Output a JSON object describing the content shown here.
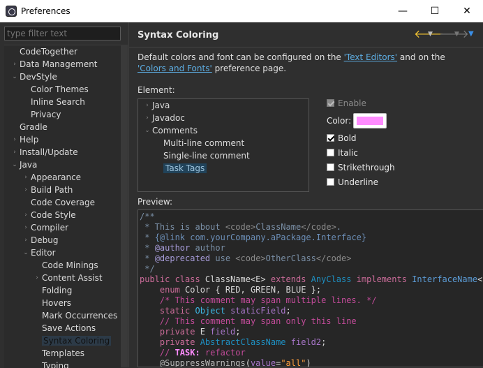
{
  "window": {
    "title": "Preferences",
    "minimize": "—",
    "maximize": "☐",
    "close": "✕"
  },
  "filter": {
    "placeholder": "type filter text"
  },
  "tree": [
    {
      "label": "CodeTogether",
      "depth": 0,
      "tw": ""
    },
    {
      "label": "Data Management",
      "depth": 0,
      "tw": "›"
    },
    {
      "label": "DevStyle",
      "depth": 0,
      "tw": "⌄"
    },
    {
      "label": "Color Themes",
      "depth": 1,
      "tw": ""
    },
    {
      "label": "Inline Search",
      "depth": 1,
      "tw": ""
    },
    {
      "label": "Privacy",
      "depth": 1,
      "tw": ""
    },
    {
      "label": "Gradle",
      "depth": 0,
      "tw": ""
    },
    {
      "label": "Help",
      "depth": 0,
      "tw": "›"
    },
    {
      "label": "Install/Update",
      "depth": 0,
      "tw": "›"
    },
    {
      "label": "Java",
      "depth": 0,
      "tw": "⌄"
    },
    {
      "label": "Appearance",
      "depth": 1,
      "tw": "›"
    },
    {
      "label": "Build Path",
      "depth": 1,
      "tw": "›"
    },
    {
      "label": "Code Coverage",
      "depth": 1,
      "tw": ""
    },
    {
      "label": "Code Style",
      "depth": 1,
      "tw": "›"
    },
    {
      "label": "Compiler",
      "depth": 1,
      "tw": "›"
    },
    {
      "label": "Debug",
      "depth": 1,
      "tw": "›"
    },
    {
      "label": "Editor",
      "depth": 1,
      "tw": "⌄"
    },
    {
      "label": "Code Minings",
      "depth": 2,
      "tw": ""
    },
    {
      "label": "Content Assist",
      "depth": 2,
      "tw": "›"
    },
    {
      "label": "Folding",
      "depth": 2,
      "tw": ""
    },
    {
      "label": "Hovers",
      "depth": 2,
      "tw": ""
    },
    {
      "label": "Mark Occurrences",
      "depth": 2,
      "tw": ""
    },
    {
      "label": "Save Actions",
      "depth": 2,
      "tw": ""
    },
    {
      "label": "Syntax Coloring",
      "depth": 2,
      "tw": "",
      "selected": true
    },
    {
      "label": "Templates",
      "depth": 2,
      "tw": ""
    },
    {
      "label": "Typing",
      "depth": 2,
      "tw": ""
    }
  ],
  "page": {
    "title": "Syntax Coloring",
    "desc_pre": "Default colors and font can be configured on the ",
    "link1": "'Text Editors'",
    "desc_mid": " and on the ",
    "link2": "'Colors and Fonts'",
    "desc_post": " preference page.",
    "element_label": "Element:",
    "preview_label": "Preview:"
  },
  "elements": [
    {
      "label": "Java",
      "depth": 0,
      "tw": "›"
    },
    {
      "label": "Javadoc",
      "depth": 0,
      "tw": "›"
    },
    {
      "label": "Comments",
      "depth": 0,
      "tw": "⌄"
    },
    {
      "label": "Multi-line comment",
      "depth": 1,
      "tw": ""
    },
    {
      "label": "Single-line comment",
      "depth": 1,
      "tw": ""
    },
    {
      "label": "Task Tags",
      "depth": 1,
      "tw": "",
      "selected": true
    }
  ],
  "options": {
    "enable": "Enable",
    "color": "Color:",
    "color_value": "#ff8cff",
    "bold": "Bold",
    "italic": "Italic",
    "strikethrough": "Strikethrough",
    "underline": "Underline",
    "bold_checked": true,
    "enable_checked": true
  },
  "code_lines": [
    [
      [
        "c-doc",
        "/**"
      ]
    ],
    [
      [
        "c-doc",
        " * This is about "
      ],
      [
        "c-docg",
        "<code>"
      ],
      [
        "c-doc",
        "ClassName"
      ],
      [
        "c-docg",
        "</code>"
      ],
      [
        "c-doc",
        "."
      ]
    ],
    [
      [
        "c-doc",
        " * "
      ],
      [
        "c-link",
        "{@link com.yourCompany.aPackage.Interface}"
      ]
    ],
    [
      [
        "c-doc",
        " * "
      ],
      [
        "c-tag",
        "@author"
      ],
      [
        "c-doc",
        " author"
      ]
    ],
    [
      [
        "c-doc",
        " * "
      ],
      [
        "c-tag",
        "@deprecated"
      ],
      [
        "c-doc",
        " use "
      ],
      [
        "c-docg",
        "<code>"
      ],
      [
        "c-doc",
        "OtherClass"
      ],
      [
        "c-docg",
        "</code>"
      ]
    ],
    [
      [
        "c-doc",
        " */"
      ]
    ],
    [
      [
        "c-kw",
        "public class "
      ],
      [
        "c-plain",
        "ClassName<E> "
      ],
      [
        "c-kw",
        "extends "
      ],
      [
        "c-type",
        "AnyClass "
      ],
      [
        "c-kw",
        "implements "
      ],
      [
        "c-ifc",
        "InterfaceName"
      ],
      [
        "c-plain",
        "<St"
      ]
    ],
    [
      [
        "c-kw",
        "    enum "
      ],
      [
        "c-plain",
        "Color { RED, GREEN, BLUE };"
      ]
    ],
    [
      [
        "c-cmt",
        "    /* This comment may span multiple lines. */"
      ]
    ],
    [
      [
        "c-kw",
        "    static "
      ],
      [
        "c-kwtype",
        "Object "
      ],
      [
        "c-field",
        "staticField"
      ],
      [
        "c-plain",
        ";"
      ]
    ],
    [
      [
        "c-line",
        "    // This comment may span only this line"
      ]
    ],
    [
      [
        "c-kw",
        "    private "
      ],
      [
        "c-plain",
        "E "
      ],
      [
        "c-field",
        "field"
      ],
      [
        "c-plain",
        ";"
      ]
    ],
    [
      [
        "c-kw",
        "    private "
      ],
      [
        "c-type",
        "AbstractClassName "
      ],
      [
        "c-field",
        "field2"
      ],
      [
        "c-plain",
        ";"
      ]
    ],
    [
      [
        "c-line",
        "    // "
      ],
      [
        "c-task",
        "TASK:"
      ],
      [
        "c-line",
        " refactor"
      ]
    ],
    [
      [
        "c-annot",
        "    @SuppressWarnings"
      ],
      [
        "c-plain",
        "("
      ],
      [
        "c-field",
        "value"
      ],
      [
        "c-plain",
        "="
      ],
      [
        "c-str",
        "\"all\""
      ],
      [
        "c-plain",
        ")"
      ]
    ]
  ]
}
